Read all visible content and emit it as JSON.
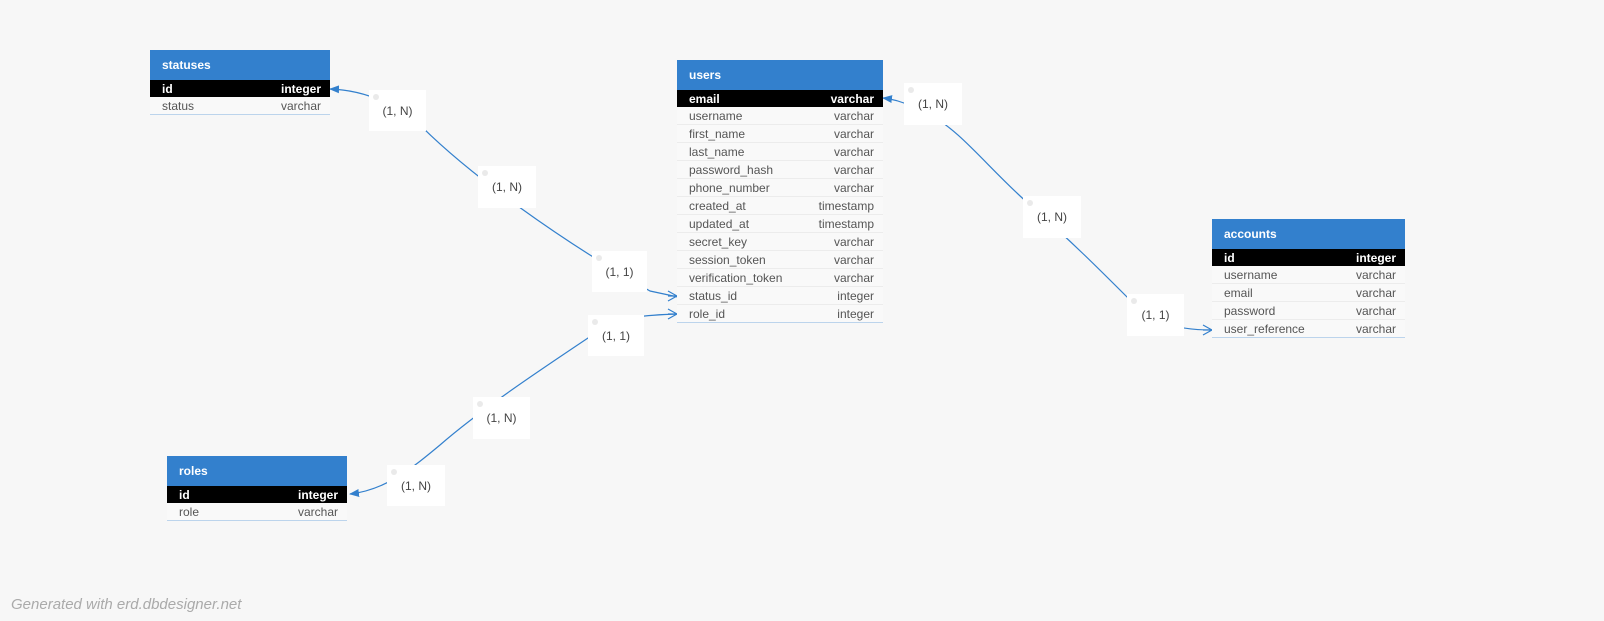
{
  "tables": {
    "statuses": {
      "name": "statuses",
      "columns": [
        {
          "name": "id",
          "type": "integer",
          "pk": true
        },
        {
          "name": "status",
          "type": "varchar"
        }
      ]
    },
    "users": {
      "name": "users",
      "columns": [
        {
          "name": "email",
          "type": "varchar",
          "pk": true
        },
        {
          "name": "username",
          "type": "varchar"
        },
        {
          "name": "first_name",
          "type": "varchar"
        },
        {
          "name": "last_name",
          "type": "varchar"
        },
        {
          "name": "password_hash",
          "type": "varchar"
        },
        {
          "name": "phone_number",
          "type": "varchar"
        },
        {
          "name": "created_at",
          "type": "timestamp"
        },
        {
          "name": "updated_at",
          "type": "timestamp"
        },
        {
          "name": "secret_key",
          "type": "varchar"
        },
        {
          "name": "session_token",
          "type": "varchar"
        },
        {
          "name": "verification_token",
          "type": "varchar"
        },
        {
          "name": "status_id",
          "type": "integer"
        },
        {
          "name": "role_id",
          "type": "integer"
        }
      ]
    },
    "accounts": {
      "name": "accounts",
      "columns": [
        {
          "name": "id",
          "type": "integer",
          "pk": true
        },
        {
          "name": "username",
          "type": "varchar"
        },
        {
          "name": "email",
          "type": "varchar"
        },
        {
          "name": "password",
          "type": "varchar"
        },
        {
          "name": "user_reference",
          "type": "varchar"
        }
      ]
    },
    "roles": {
      "name": "roles",
      "columns": [
        {
          "name": "id",
          "type": "integer",
          "pk": true
        },
        {
          "name": "role",
          "type": "varchar"
        }
      ]
    }
  },
  "relations": [
    {
      "from": "users.status_id",
      "to": "statuses.id",
      "labels": [
        "(1, N)",
        "(1, N)",
        "(1, 1)"
      ]
    },
    {
      "from": "users.role_id",
      "to": "roles.id",
      "labels": [
        "(1, 1)",
        "(1, N)",
        "(1, N)"
      ]
    },
    {
      "from": "accounts.user_reference",
      "to": "users.email",
      "labels": [
        "(1, N)",
        "(1, N)",
        "(1, 1)"
      ]
    }
  ],
  "footer": "Generated with erd.dbdesigner.net",
  "colors": {
    "header": "#3380cd",
    "link": "#3380cd",
    "pk_row": "#000000",
    "background": "#f7f7f7"
  }
}
